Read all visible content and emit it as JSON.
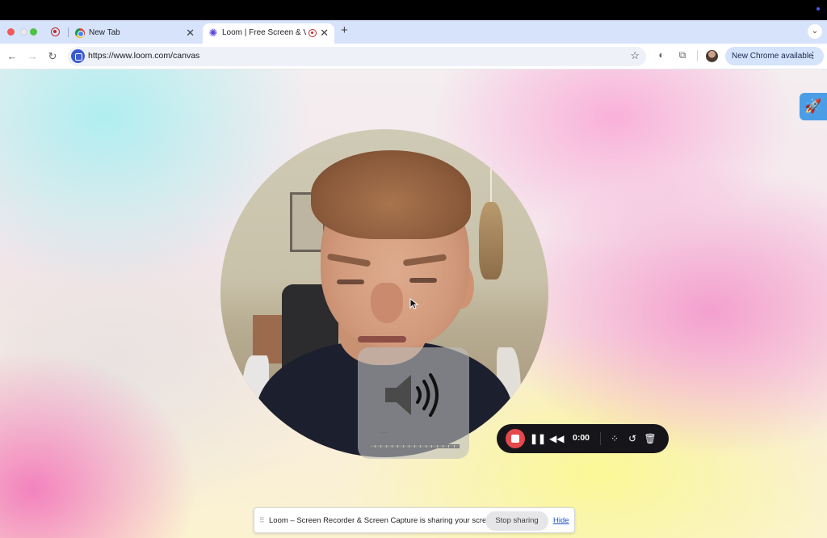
{
  "browser": {
    "tabs": [
      {
        "title": "New Tab",
        "close_glyph": "✕"
      },
      {
        "title": "Loom | Free Screen & Vide",
        "close_glyph": "✕"
      }
    ],
    "new_tab_glyph": "+",
    "tab_menu_glyph": "⌄",
    "url": "https://www.loom.com/canvas",
    "update_button": "New Chrome available",
    "update_menu_glyph": "⋮"
  },
  "icons": {
    "back": "←",
    "forward": "→",
    "reload": "↻",
    "star": "☆",
    "extension_loom": "◐",
    "extensions": "⧉",
    "rocket": "🚀",
    "pause": "❚❚",
    "rewind": "◀◀",
    "grid": "⁘",
    "restart": "↺",
    "trash": "🗑"
  },
  "recorder": {
    "timer": "0:00",
    "recording_color": "#e5484d"
  },
  "volume_overlay": {
    "ellipsis": "···"
  },
  "share_bar": {
    "grip": "⠿",
    "message": "Loom – Screen Recorder & Screen Capture is sharing your screen.",
    "stop_label": "Stop sharing",
    "hide_label": "Hide"
  }
}
